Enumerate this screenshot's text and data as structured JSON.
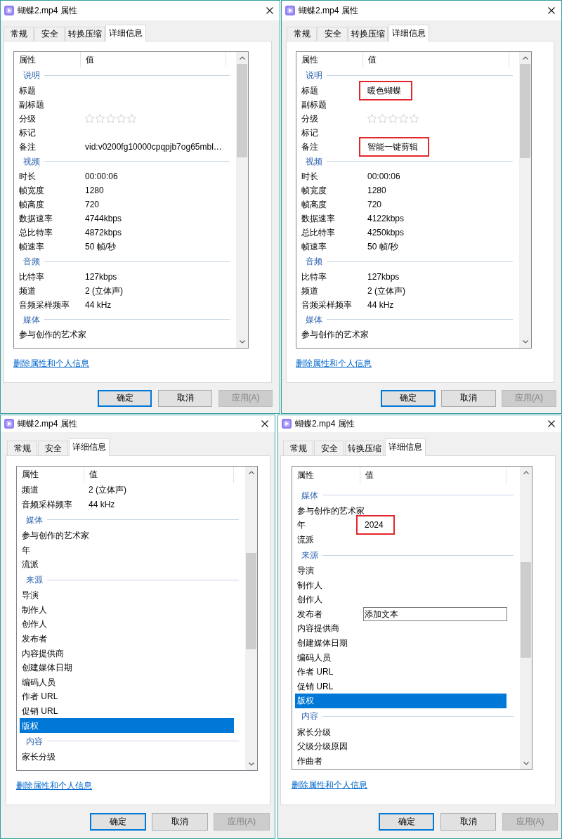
{
  "dialogs": [
    {
      "title": "蝴蝶2.mp4 属性",
      "tabs": [
        {
          "label": "常规",
          "selected": false
        },
        {
          "label": "安全",
          "selected": false
        },
        {
          "label": "转换压缩",
          "selected": false
        },
        {
          "label": "详细信息",
          "selected": true
        }
      ],
      "list": {
        "columns": [
          "属性",
          "值"
        ],
        "rows": [
          {
            "kind": "group",
            "label": "说明"
          },
          {
            "kind": "property",
            "name": "标题",
            "selected": false,
            "highlighted": false
          },
          {
            "kind": "property",
            "name": "副标题",
            "selected": false,
            "highlighted": false
          },
          {
            "kind": "rating",
            "name": "分级",
            "stars": 0,
            "selected": false
          },
          {
            "kind": "property",
            "name": "标记",
            "selected": false,
            "highlighted": false
          },
          {
            "kind": "property",
            "name": "备注",
            "value": "vid:v0200fg10000cpqpjb7og65mbl…",
            "selected": false,
            "highlighted": false
          },
          {
            "kind": "group",
            "label": "视频"
          },
          {
            "kind": "property",
            "name": "时长",
            "value": "00:00:06",
            "selected": false,
            "highlighted": false
          },
          {
            "kind": "property",
            "name": "帧宽度",
            "value": "1280",
            "selected": false,
            "highlighted": false
          },
          {
            "kind": "property",
            "name": "帧高度",
            "value": "720",
            "selected": false,
            "highlighted": false
          },
          {
            "kind": "property",
            "name": "数据速率",
            "value": "4744kbps",
            "selected": false,
            "highlighted": false
          },
          {
            "kind": "property",
            "name": "总比特率",
            "value": "4872kbps",
            "selected": false,
            "highlighted": false
          },
          {
            "kind": "property",
            "name": "帧速率",
            "value": "50 帧/秒",
            "selected": false,
            "highlighted": false
          },
          {
            "kind": "group",
            "label": "音频"
          },
          {
            "kind": "property",
            "name": "比特率",
            "value": "127kbps",
            "selected": false,
            "highlighted": false
          },
          {
            "kind": "property",
            "name": "频道",
            "value": "2 (立体声)",
            "selected": false,
            "highlighted": false
          },
          {
            "kind": "property",
            "name": "音频采样频率",
            "value": "44 kHz",
            "selected": false,
            "highlighted": false
          },
          {
            "kind": "group",
            "label": "媒体"
          },
          {
            "kind": "property",
            "name": "参与创作的艺术家",
            "selected": false,
            "highlighted": false
          }
        ]
      },
      "link": "删除属性和个人信息",
      "buttons": [
        {
          "label": "确定",
          "default": true,
          "disabled": false
        },
        {
          "label": "取消",
          "default": false,
          "disabled": false
        },
        {
          "label": "应用(A)",
          "default": false,
          "disabled": true
        }
      ]
    },
    {
      "title": "蝴蝶2.mp4 属性",
      "tabs": [
        {
          "label": "常规",
          "selected": false
        },
        {
          "label": "安全",
          "selected": false
        },
        {
          "label": "转换压缩",
          "selected": false
        },
        {
          "label": "详细信息",
          "selected": true
        }
      ],
      "list": {
        "columns": [
          "属性",
          "值"
        ],
        "rows": [
          {
            "kind": "group",
            "label": "说明"
          },
          {
            "kind": "property",
            "name": "标题",
            "value": "暖色蝴蝶",
            "selected": false,
            "highlighted": true
          },
          {
            "kind": "property",
            "name": "副标题",
            "selected": false,
            "highlighted": false
          },
          {
            "kind": "rating",
            "name": "分级",
            "stars": 0,
            "selected": false
          },
          {
            "kind": "property",
            "name": "标记",
            "selected": false,
            "highlighted": false
          },
          {
            "kind": "property",
            "name": "备注",
            "value": "智能一键剪辑",
            "selected": false,
            "highlighted": true
          },
          {
            "kind": "group",
            "label": "视频"
          },
          {
            "kind": "property",
            "name": "时长",
            "value": "00:00:06",
            "selected": false,
            "highlighted": false
          },
          {
            "kind": "property",
            "name": "帧宽度",
            "value": "1280",
            "selected": false,
            "highlighted": false
          },
          {
            "kind": "property",
            "name": "帧高度",
            "value": "720",
            "selected": false,
            "highlighted": false
          },
          {
            "kind": "property",
            "name": "数据速率",
            "value": "4122kbps",
            "selected": false,
            "highlighted": false
          },
          {
            "kind": "property",
            "name": "总比特率",
            "value": "4250kbps",
            "selected": false,
            "highlighted": false
          },
          {
            "kind": "property",
            "name": "帧速率",
            "value": "50 帧/秒",
            "selected": false,
            "highlighted": false
          },
          {
            "kind": "group",
            "label": "音频"
          },
          {
            "kind": "property",
            "name": "比特率",
            "value": "127kbps",
            "selected": false,
            "highlighted": false
          },
          {
            "kind": "property",
            "name": "频道",
            "value": "2 (立体声)",
            "selected": false,
            "highlighted": false
          },
          {
            "kind": "property",
            "name": "音频采样频率",
            "value": "44 kHz",
            "selected": false,
            "highlighted": false
          },
          {
            "kind": "group",
            "label": "媒体"
          },
          {
            "kind": "property",
            "name": "参与创作的艺术家",
            "selected": false,
            "highlighted": false
          }
        ]
      },
      "link": "删除属性和个人信息",
      "buttons": [
        {
          "label": "确定",
          "default": true,
          "disabled": false
        },
        {
          "label": "取消",
          "default": false,
          "disabled": false
        },
        {
          "label": "应用(A)",
          "default": false,
          "disabled": true
        }
      ]
    },
    {
      "title": "蝴蝶2.mp4 属性",
      "tabs": [
        {
          "label": "常规",
          "selected": false
        },
        {
          "label": "安全",
          "selected": false
        },
        {
          "label": "详细信息",
          "selected": true
        }
      ],
      "list": {
        "columns": [
          "属性",
          "值"
        ],
        "rows": [
          {
            "kind": "property",
            "name": "频道",
            "value": "2 (立体声)",
            "selected": false,
            "highlighted": false
          },
          {
            "kind": "property",
            "name": "音频采样频率",
            "value": "44 kHz",
            "selected": false,
            "highlighted": false
          },
          {
            "kind": "group",
            "label": "媒体"
          },
          {
            "kind": "property",
            "name": "参与创作的艺术家",
            "selected": false,
            "highlighted": false
          },
          {
            "kind": "property",
            "name": "年",
            "selected": false,
            "highlighted": false
          },
          {
            "kind": "property",
            "name": "流派",
            "selected": false,
            "highlighted": false
          },
          {
            "kind": "group",
            "label": "来源"
          },
          {
            "kind": "property",
            "name": "导演",
            "selected": false,
            "highlighted": false
          },
          {
            "kind": "property",
            "name": "制作人",
            "selected": false,
            "highlighted": false
          },
          {
            "kind": "property",
            "name": "创作人",
            "selected": false,
            "highlighted": false
          },
          {
            "kind": "property",
            "name": "发布者",
            "selected": false,
            "highlighted": false
          },
          {
            "kind": "property",
            "name": "内容提供商",
            "selected": false,
            "highlighted": false
          },
          {
            "kind": "property",
            "name": "创建媒体日期",
            "selected": false,
            "highlighted": false
          },
          {
            "kind": "property",
            "name": "编码人员",
            "selected": false,
            "highlighted": false
          },
          {
            "kind": "property",
            "name": "作者 URL",
            "selected": false,
            "highlighted": false
          },
          {
            "kind": "property",
            "name": "促销 URL",
            "selected": false,
            "highlighted": false
          },
          {
            "kind": "property",
            "name": "版权",
            "selected": true,
            "highlighted": false
          },
          {
            "kind": "group",
            "label": "内容"
          },
          {
            "kind": "property",
            "name": "家长分级",
            "selected": false,
            "highlighted": false
          }
        ]
      },
      "link": "删除属性和个人信息",
      "buttons": [
        {
          "label": "确定",
          "default": true,
          "disabled": false
        },
        {
          "label": "取消",
          "default": false,
          "disabled": false
        },
        {
          "label": "应用(A)",
          "default": false,
          "disabled": true
        }
      ]
    },
    {
      "title": "蝴蝶2.mp4 属性",
      "tabs": [
        {
          "label": "常规",
          "selected": false
        },
        {
          "label": "安全",
          "selected": false
        },
        {
          "label": "转换压缩",
          "selected": false
        },
        {
          "label": "详细信息",
          "selected": true
        }
      ],
      "list": {
        "columns": [
          "属性",
          "值"
        ],
        "rows": [
          {
            "kind": "group",
            "label": "媒体"
          },
          {
            "kind": "property",
            "name": "参与创作的艺术家",
            "selected": false,
            "highlighted": false
          },
          {
            "kind": "property",
            "name": "年",
            "value": "2024",
            "selected": false,
            "highlighted": true
          },
          {
            "kind": "property",
            "name": "流派",
            "selected": false,
            "highlighted": false
          },
          {
            "kind": "group",
            "label": "来源"
          },
          {
            "kind": "property",
            "name": "导演",
            "selected": false,
            "highlighted": false
          },
          {
            "kind": "property",
            "name": "制作人",
            "selected": false,
            "highlighted": false
          },
          {
            "kind": "property",
            "name": "创作人",
            "selected": false,
            "highlighted": false
          },
          {
            "kind": "edit",
            "name": "发布者",
            "placeholder": "添加文本",
            "selected": false
          },
          {
            "kind": "property",
            "name": "内容提供商",
            "selected": false,
            "highlighted": false
          },
          {
            "kind": "property",
            "name": "创建媒体日期",
            "selected": false,
            "highlighted": false
          },
          {
            "kind": "property",
            "name": "编码人员",
            "selected": false,
            "highlighted": false
          },
          {
            "kind": "property",
            "name": "作者 URL",
            "selected": false,
            "highlighted": false
          },
          {
            "kind": "property",
            "name": "促销 URL",
            "selected": false,
            "highlighted": false
          },
          {
            "kind": "property",
            "name": "版权",
            "selected": true,
            "highlighted": false
          },
          {
            "kind": "group",
            "label": "内容"
          },
          {
            "kind": "property",
            "name": "家长分级",
            "selected": false,
            "highlighted": false
          },
          {
            "kind": "property",
            "name": "父级分级原因",
            "selected": false,
            "highlighted": false
          },
          {
            "kind": "property",
            "name": "作曲者",
            "selected": false,
            "highlighted": false
          }
        ]
      },
      "link": "删除属性和个人信息",
      "buttons": [
        {
          "label": "确定",
          "default": true,
          "disabled": false
        },
        {
          "label": "取消",
          "default": false,
          "disabled": false
        },
        {
          "label": "应用(A)",
          "default": false,
          "disabled": true
        }
      ]
    }
  ]
}
